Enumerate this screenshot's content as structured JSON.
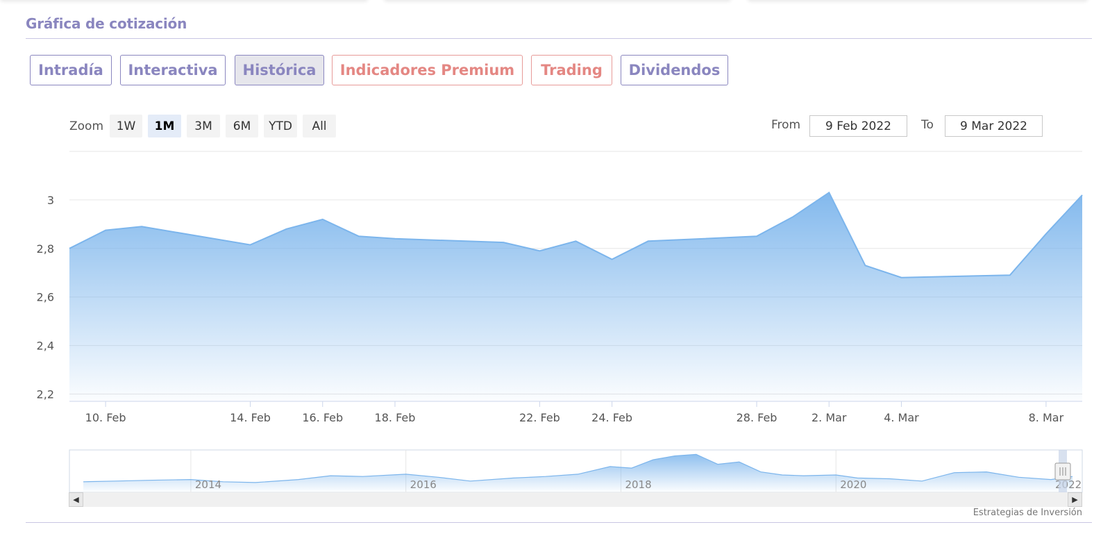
{
  "section": {
    "title": "Gráfica de cotización"
  },
  "tabs": [
    {
      "label": "Intradía"
    },
    {
      "label": "Interactiva"
    },
    {
      "label": "Histórica"
    },
    {
      "label": "Indicadores Premium"
    },
    {
      "label": "Trading"
    },
    {
      "label": "Dividendos"
    }
  ],
  "zoom": {
    "label": "Zoom",
    "options": [
      "1W",
      "1M",
      "3M",
      "6M",
      "YTD",
      "All"
    ],
    "selected": "1M"
  },
  "range": {
    "from_label": "From",
    "from_value": "9 Feb 2022",
    "to_label": "To",
    "to_value": "9 Mar 2022"
  },
  "credit": "Estrategias de Inversión",
  "colors": {
    "accent": "#8a86bf",
    "red_tab": "#e48783",
    "area_line": "#7cb5ec",
    "grid": "#e6e6e6"
  },
  "chart_data": {
    "type": "area",
    "x": [
      "2022-02-09",
      "2022-02-10",
      "2022-02-11",
      "2022-02-14",
      "2022-02-15",
      "2022-02-16",
      "2022-02-17",
      "2022-02-18",
      "2022-02-21",
      "2022-02-22",
      "2022-02-23",
      "2022-02-24",
      "2022-02-25",
      "2022-02-28",
      "2022-03-01",
      "2022-03-02",
      "2022-03-03",
      "2022-03-04",
      "2022-03-07",
      "2022-03-08",
      "2022-03-09"
    ],
    "values": [
      2.8,
      2.875,
      2.89,
      2.815,
      2.88,
      2.92,
      2.85,
      2.84,
      2.825,
      2.79,
      2.83,
      2.755,
      2.83,
      2.85,
      2.93,
      3.03,
      2.73,
      2.68,
      2.69,
      2.86,
      3.02
    ],
    "ylim": [
      2.17,
      3.2
    ],
    "yticks": [
      2.2,
      2.4,
      2.6,
      2.8,
      3.0
    ],
    "ytick_labels": [
      "2,2",
      "2,4",
      "2,6",
      "2,8",
      "3"
    ],
    "xtick_dates": [
      "2022-02-10",
      "2022-02-14",
      "2022-02-16",
      "2022-02-18",
      "2022-02-22",
      "2022-02-24",
      "2022-02-28",
      "2022-03-02",
      "2022-03-04",
      "2022-03-08"
    ],
    "xtick_labels": [
      "10. Feb",
      "14. Feb",
      "16. Feb",
      "18. Feb",
      "22. Feb",
      "24. Feb",
      "28. Feb",
      "2. Mar",
      "4. Mar",
      "8. Mar"
    ],
    "grid": true,
    "navigator": {
      "years": [
        2014,
        2016,
        2018,
        2020,
        2022
      ],
      "year_labels": [
        "2014",
        "2016",
        "2018",
        "2020",
        "2022"
      ],
      "x": [
        2013.0,
        2013.3,
        2013.6,
        2014.0,
        2014.3,
        2014.6,
        2015.0,
        2015.3,
        2015.6,
        2016.0,
        2016.3,
        2016.6,
        2017.0,
        2017.3,
        2017.6,
        2017.9,
        2018.1,
        2018.3,
        2018.5,
        2018.7,
        2018.9,
        2019.1,
        2019.3,
        2019.5,
        2019.7,
        2020.0,
        2020.2,
        2020.5,
        2020.8,
        2021.1,
        2021.4,
        2021.7,
        2022.0,
        2022.2
      ],
      "values": [
        2.6,
        2.65,
        2.7,
        2.75,
        2.6,
        2.55,
        2.75,
        3.0,
        2.95,
        3.1,
        2.9,
        2.65,
        2.85,
        2.95,
        3.1,
        3.6,
        3.5,
        4.05,
        4.3,
        4.4,
        3.75,
        3.9,
        3.25,
        3.05,
        3.0,
        3.05,
        2.85,
        2.8,
        2.65,
        3.2,
        3.25,
        2.9,
        2.75,
        2.95
      ],
      "ylim": [
        2.0,
        4.6
      ]
    }
  }
}
